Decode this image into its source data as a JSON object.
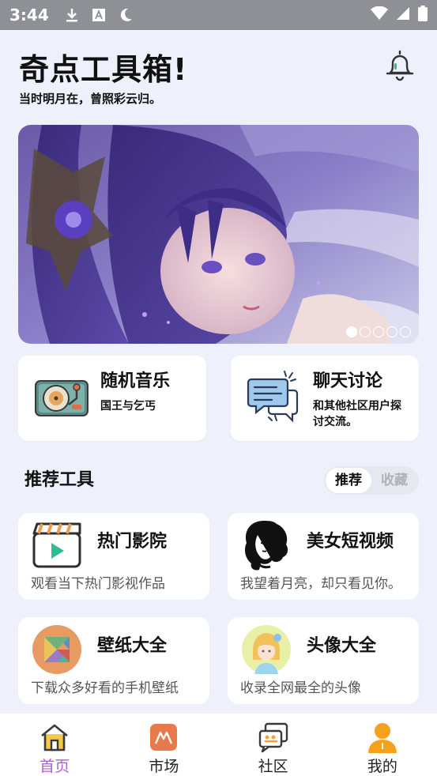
{
  "status_bar": {
    "time": "3:44"
  },
  "header": {
    "title": "奇点工具箱!",
    "subtitle": "当时明月在，曾照彩云归。"
  },
  "banner": {
    "dot_count": 5,
    "active_dot": 0
  },
  "features": [
    {
      "title": "随机音乐",
      "subtitle": "国王与乞丐",
      "icon": "record-player-icon"
    },
    {
      "title": "聊天讨论",
      "subtitle": "和其他社区用户探讨交流。",
      "icon": "chat-bubbles-icon"
    }
  ],
  "tools_section": {
    "title": "推荐工具",
    "toggle": [
      "推荐",
      "收藏"
    ],
    "selected": "推荐"
  },
  "tools": [
    {
      "name": "热门影院",
      "desc": "观看当下热门影视作品",
      "icon": "clapperboard-icon"
    },
    {
      "name": "美女短视频",
      "desc": "我望着月亮，却只看见你。",
      "icon": "woman-silhouette-icon"
    },
    {
      "name": "壁纸大全",
      "desc": "下载众多好看的手机壁纸",
      "icon": "tangram-icon"
    },
    {
      "name": "头像大全",
      "desc": "收录全网最全的头像",
      "icon": "avatar-girl-icon"
    }
  ],
  "tabbar": {
    "items": [
      {
        "label": "首页",
        "icon": "home-icon"
      },
      {
        "label": "市场",
        "icon": "market-icon"
      },
      {
        "label": "社区",
        "icon": "community-icon"
      },
      {
        "label": "我的",
        "icon": "profile-icon"
      }
    ],
    "active": 0
  },
  "colors": {
    "accent": "#b05cd6",
    "background": "#eef1fb",
    "statusbar": "#8f9095"
  }
}
